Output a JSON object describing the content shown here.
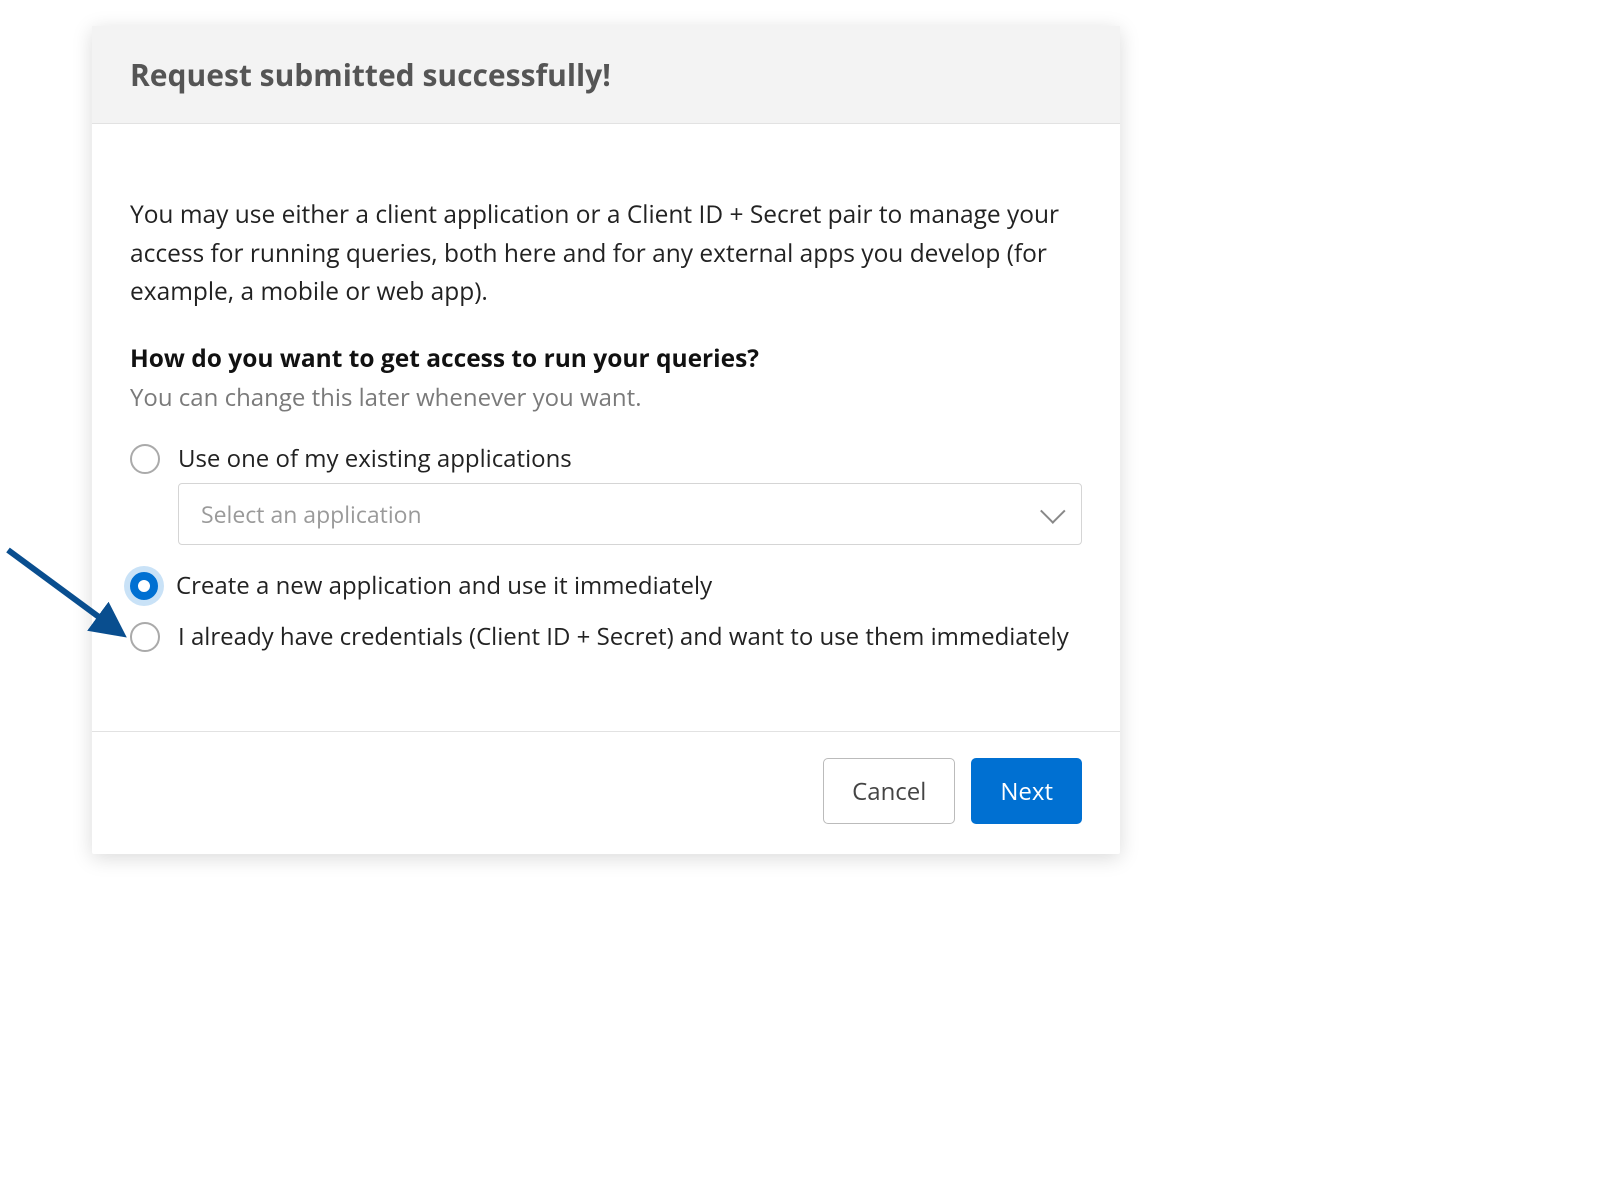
{
  "modal": {
    "title": "Request submitted successfully!",
    "intro": "You may use either a client application or a Client ID + Secret pair to manage your access for running queries, both here and for any external apps you develop (for example, a mobile or web app).",
    "question": "How do you want to get access to run your queries?",
    "question_sub": "You can change this later whenever you want.",
    "options": {
      "existing": {
        "label": "Use one of my existing applications",
        "selected": false,
        "select_placeholder": "Select an application"
      },
      "create_new": {
        "label": "Create a new application and use it immediately",
        "selected": true
      },
      "have_credentials": {
        "label": "I already have credentials (Client ID + Secret) and want to use them immediately",
        "selected": false
      }
    },
    "buttons": {
      "cancel": "Cancel",
      "next": "Next"
    }
  },
  "colors": {
    "primary": "#0070d2",
    "arrow": "#094e8f"
  }
}
